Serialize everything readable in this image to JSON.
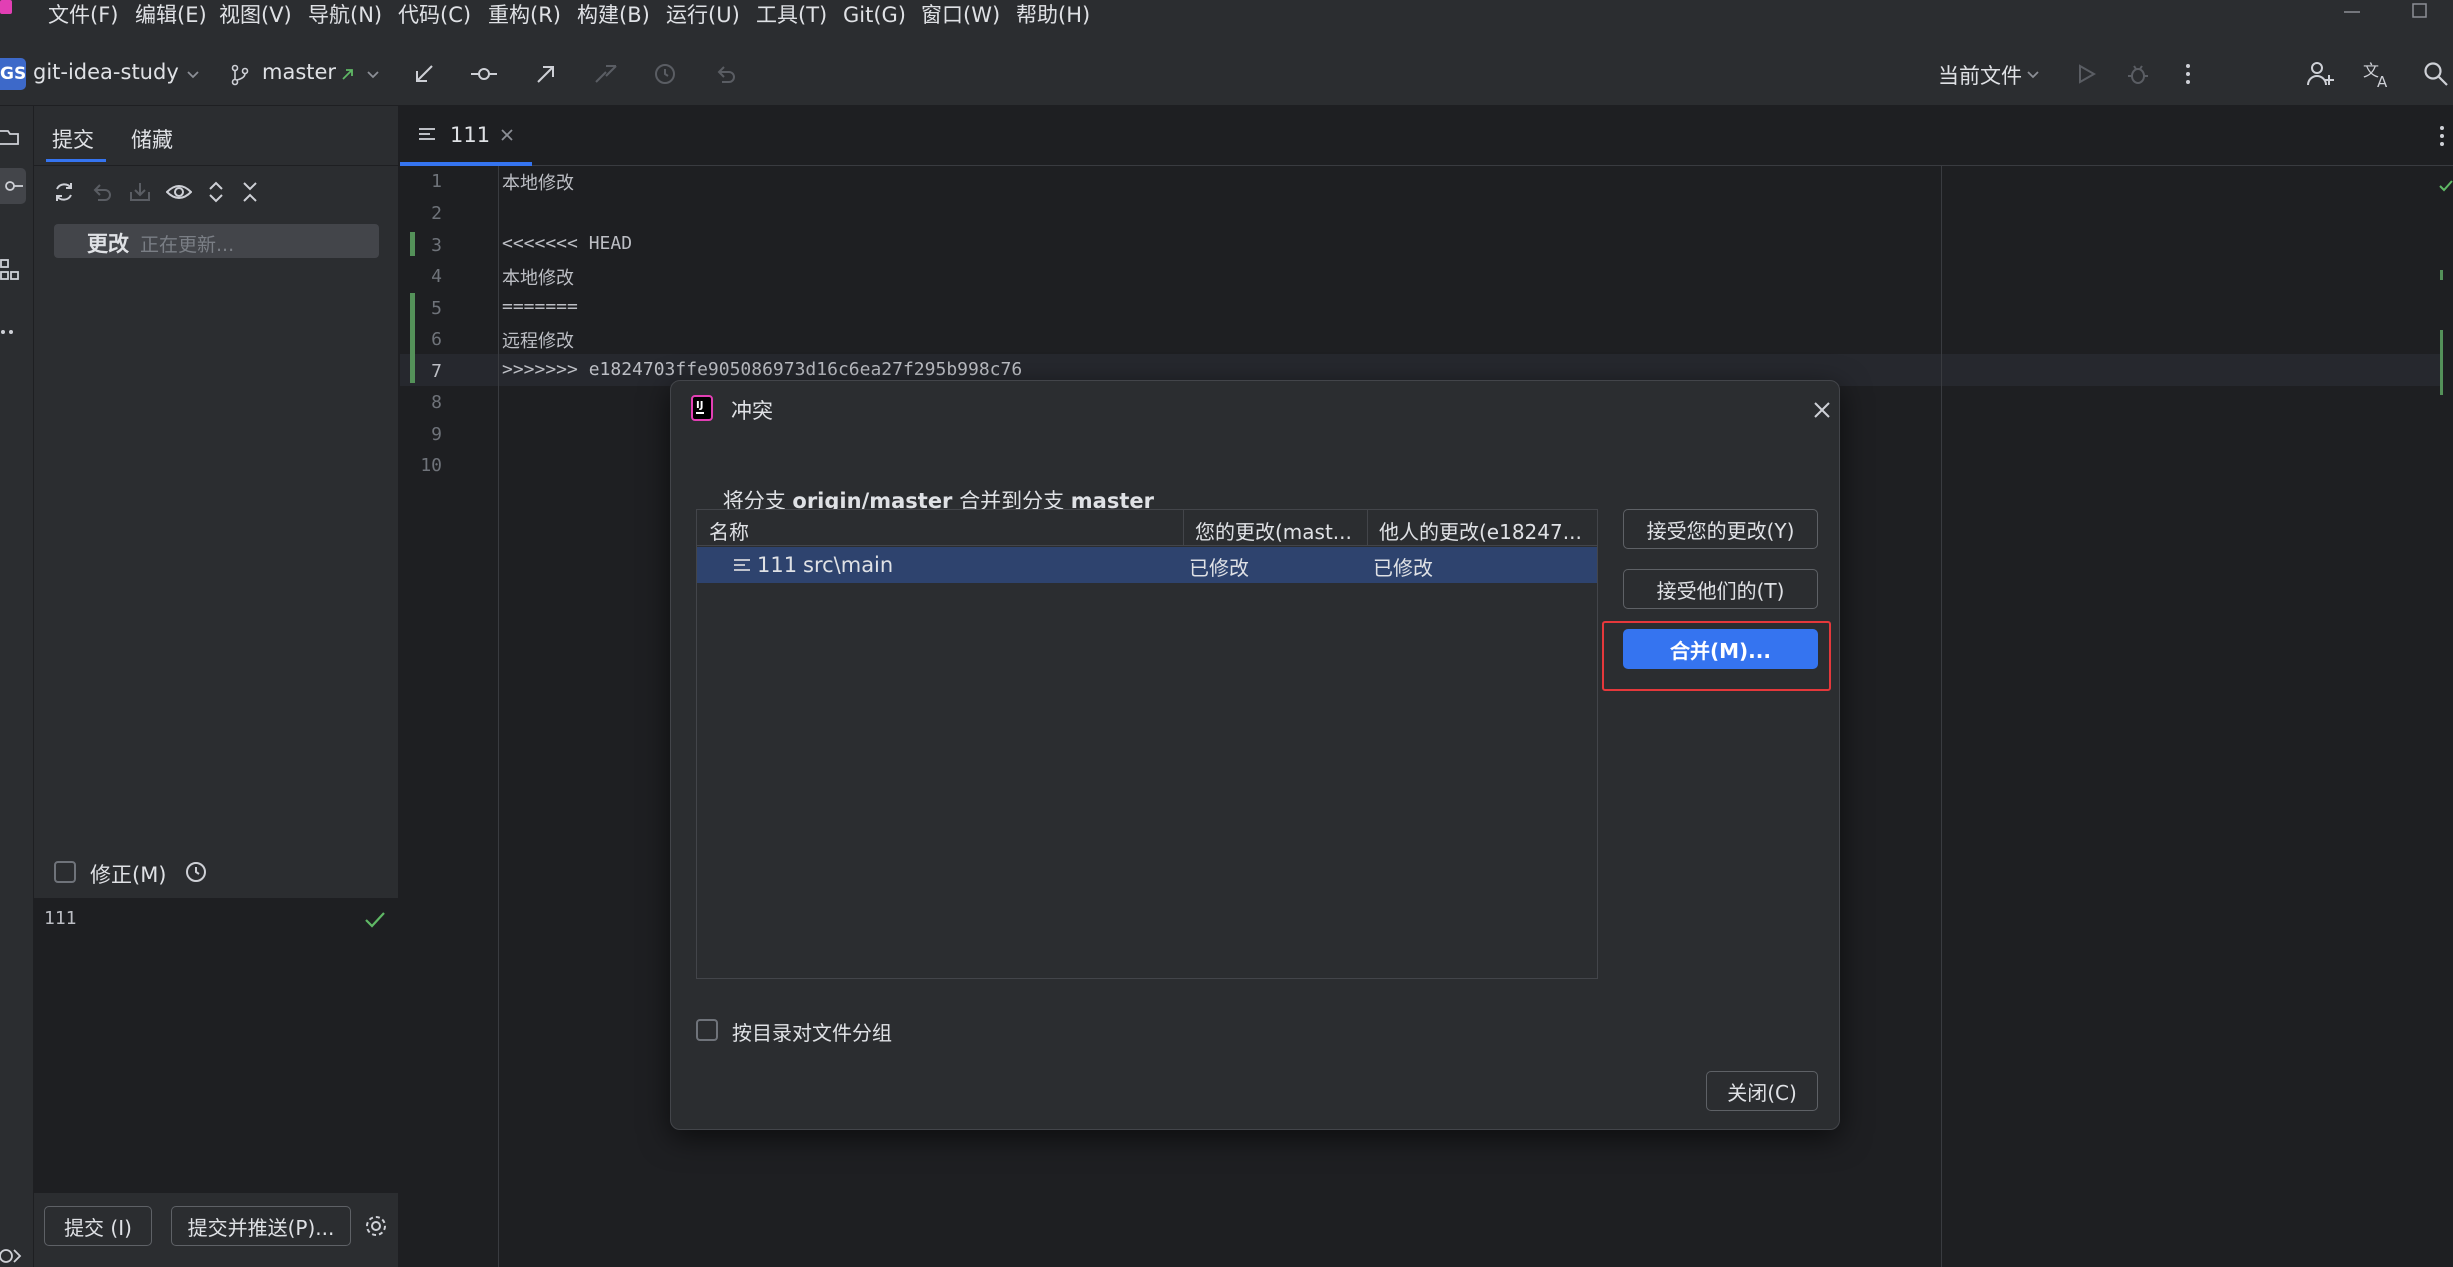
{
  "menubar": {
    "items": [
      "文件(F)",
      "编辑(E)",
      "视图(V)",
      "导航(N)",
      "代码(C)",
      "重构(R)",
      "构建(B)",
      "运行(U)",
      "工具(T)",
      "Git(G)",
      "窗口(W)",
      "帮助(H)"
    ]
  },
  "toolbar": {
    "project_badge": "GS",
    "project_name": "git-idea-study",
    "branch": "master",
    "run_config": "当前文件"
  },
  "commit_panel": {
    "tabs": [
      "提交",
      "储藏"
    ],
    "changes_label": "更改",
    "changes_status": "正在更新...",
    "amend_label": "修正(M)",
    "message": "111",
    "commit_button": "提交 (I)",
    "commit_push_button": "提交并推送(P)..."
  },
  "editor": {
    "tab_label": "111",
    "line_numbers": [
      "1",
      "2",
      "3",
      "4",
      "5",
      "6",
      "7",
      "8",
      "9",
      "10"
    ],
    "lines": [
      "本地修改",
      "",
      "<<<<<<< HEAD",
      "本地修改",
      "=======",
      "远程修改",
      ">>>>>>> e1824703ffe905086973d16c6ea27f295b998c76",
      "",
      "",
      ""
    ]
  },
  "dialog": {
    "title": "冲突",
    "subtitle_prefix": "将分支 ",
    "subtitle_from": "origin/master",
    "subtitle_mid": " 合并到分支 ",
    "subtitle_to": "master",
    "columns": [
      "名称",
      "您的更改(mast...",
      "他人的更改(e18247..."
    ],
    "rows": [
      {
        "name": "111",
        "path": "src\\main",
        "yours": "已修改",
        "theirs": "已修改"
      }
    ],
    "accept_yours": "接受您的更改(Y)",
    "accept_theirs": "接受他们的(T)",
    "merge": "合并(M)...",
    "group_by_dir": "按目录对文件分组",
    "close": "关闭(C)"
  },
  "colors": {
    "accent": "#3574f0",
    "selection": "#2e436e",
    "highlight_box": "#e5383b",
    "change_marker": "#549159"
  }
}
